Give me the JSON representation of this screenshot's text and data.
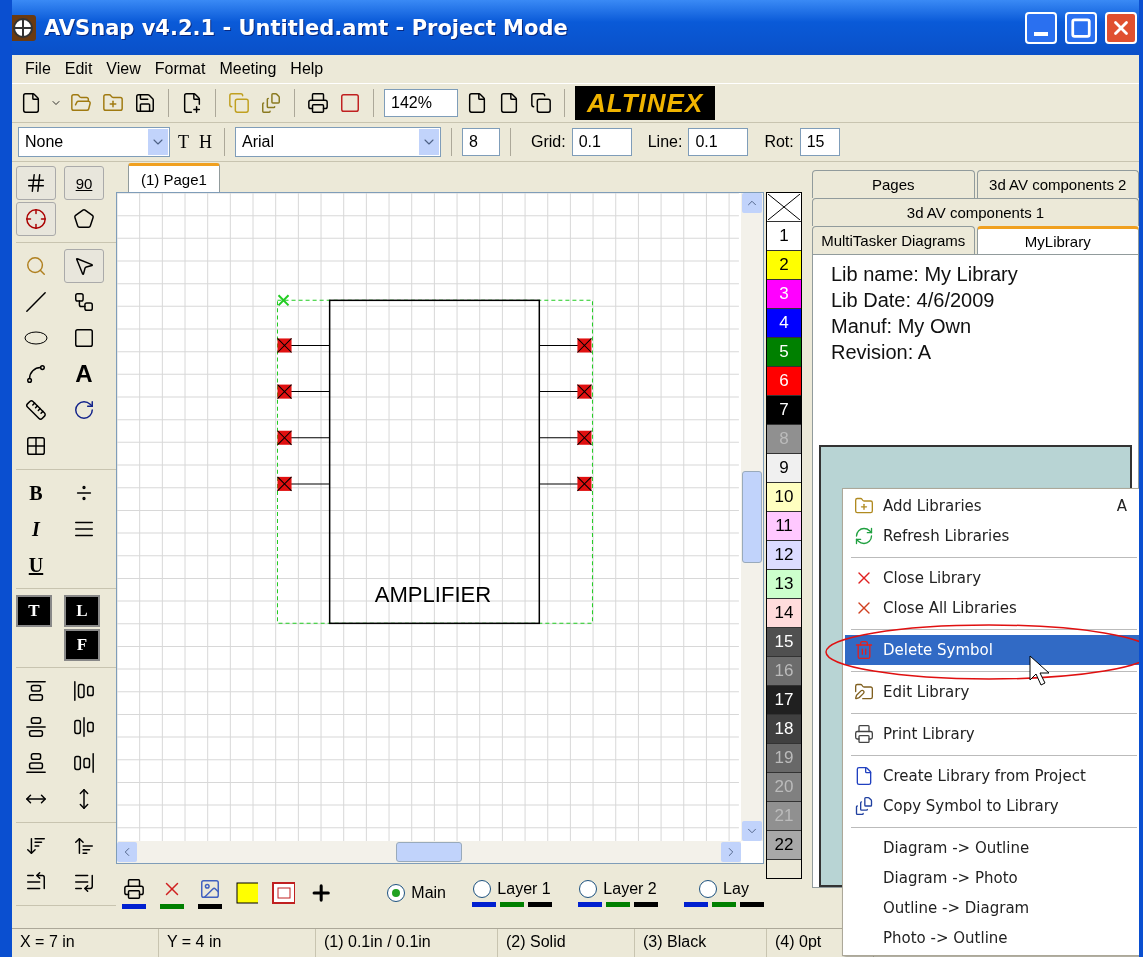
{
  "window": {
    "title": "AVSnap v4.2.1 - Untitled.amt  - Project Mode"
  },
  "menu": [
    "File",
    "Edit",
    "View",
    "Format",
    "Meeting",
    "Help"
  ],
  "toolbar": {
    "zoom": "142%",
    "logo": "ALTINEX"
  },
  "format_bar": {
    "style": "None",
    "text_button": "T",
    "h_button": "H",
    "font": "Arial",
    "size": "8",
    "grid_label": "Grid:",
    "grid": "0.1",
    "line_label": "Line:",
    "line": "0.1",
    "rot_label": "Rot:",
    "rot": "15"
  },
  "tools": {
    "angle": "90",
    "text": "A",
    "bold": "B",
    "italic": "I",
    "underline": "U",
    "text_color": "T",
    "line_color": "L",
    "fill_color": "F"
  },
  "page_tabs": [
    {
      "label": "(1) Page1",
      "selected": true
    }
  ],
  "canvas": {
    "symbol_label": "AMPLIFIER"
  },
  "colors": [
    {
      "label": "1",
      "color": "#ffffff"
    },
    {
      "label": "2",
      "color": "#ffff00"
    },
    {
      "label": "3",
      "color": "#ff00ff"
    },
    {
      "label": "4",
      "color": "#0000ff"
    },
    {
      "label": "5",
      "color": "#008000"
    },
    {
      "label": "6",
      "color": "#ff0000"
    },
    {
      "label": "7",
      "color": "#000000"
    },
    {
      "label": "8",
      "color": "#909090"
    },
    {
      "label": "9",
      "color": "#f0f0f0"
    },
    {
      "label": "10",
      "color": "#ffffc0"
    },
    {
      "label": "11",
      "color": "#ffc8ff"
    },
    {
      "label": "12",
      "color": "#dcdcff"
    },
    {
      "label": "13",
      "color": "#ccffcc"
    },
    {
      "label": "14",
      "color": "#ffdcdc"
    },
    {
      "label": "15",
      "color": "#505050"
    },
    {
      "label": "16",
      "color": "#6c6c6c"
    },
    {
      "label": "17",
      "color": "#202020"
    },
    {
      "label": "18",
      "color": "#404040"
    },
    {
      "label": "19",
      "color": "#686868"
    },
    {
      "label": "20",
      "color": "#808080"
    },
    {
      "label": "21",
      "color": "#909090"
    },
    {
      "label": "22",
      "color": "#a8a8a8"
    }
  ],
  "library_tabs": [
    [
      {
        "label": "Pages",
        "selected": false
      },
      {
        "label": "3d AV components 2",
        "selected": false
      }
    ],
    [
      {
        "label": "3d AV components 1",
        "selected": false
      }
    ],
    [
      {
        "label": "MultiTasker Diagrams",
        "selected": false
      },
      {
        "label": "MyLibrary",
        "selected": true
      }
    ]
  ],
  "library_info": [
    "Lib name: My Library",
    "Lib Date: 4/6/2009",
    "Manuf:  My Own",
    "Revision: A"
  ],
  "context_menu": [
    {
      "kind": "item",
      "label": "Add Libraries",
      "shortcut": "A",
      "selected": false
    },
    {
      "kind": "item",
      "label": "Refresh Libraries",
      "selected": false
    },
    {
      "kind": "separator"
    },
    {
      "kind": "item",
      "label": "Close Library",
      "selected": false
    },
    {
      "kind": "item",
      "label": "Close All Libraries",
      "selected": false
    },
    {
      "kind": "separator"
    },
    {
      "kind": "item",
      "label": "Delete Symbol",
      "selected": true
    },
    {
      "kind": "separator"
    },
    {
      "kind": "item",
      "label": "Edit Library",
      "selected": false
    },
    {
      "kind": "separator"
    },
    {
      "kind": "item",
      "label": "Print Library",
      "selected": false
    },
    {
      "kind": "separator"
    },
    {
      "kind": "item",
      "label": "Create Library from Project",
      "selected": false
    },
    {
      "kind": "item",
      "label": "Copy Symbol to Library",
      "selected": false
    },
    {
      "kind": "separator"
    },
    {
      "kind": "item",
      "label": "Diagram -> Outline",
      "selected": false
    },
    {
      "kind": "item",
      "label": "Diagram -> Photo",
      "selected": false
    },
    {
      "kind": "item",
      "label": "Outline -> Diagram",
      "selected": false
    },
    {
      "kind": "item",
      "label": "Photo -> Outline",
      "selected": false
    }
  ],
  "layers": [
    {
      "label": "Main",
      "selected": true
    },
    {
      "label": "Layer 1",
      "selected": false
    },
    {
      "label": "Layer 2",
      "selected": false
    },
    {
      "label": "Lay",
      "selected": false
    }
  ],
  "status_bar": [
    "X = 7 in",
    "Y = 4 in",
    "(1) 0.1in / 0.1in",
    "(2) Solid",
    "(3) Black",
    "(4) 0pt"
  ]
}
